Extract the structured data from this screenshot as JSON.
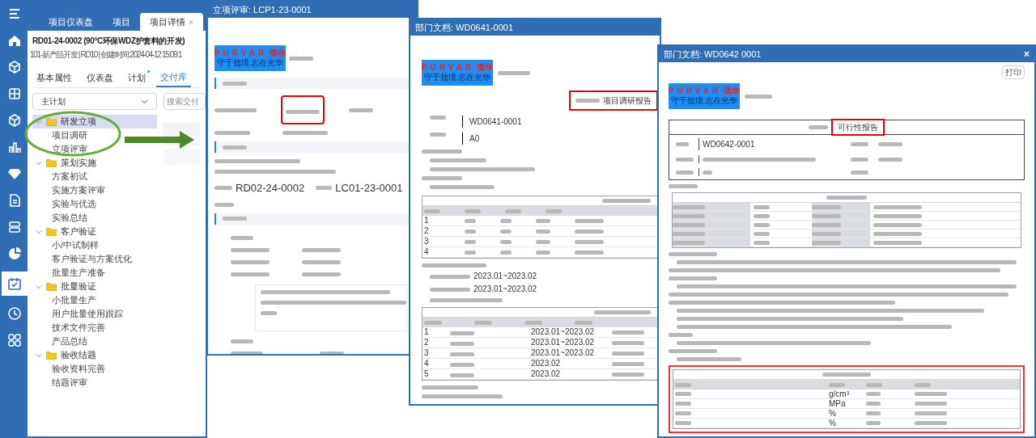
{
  "nav_items": [
    {
      "kind": "menu",
      "selected": false
    },
    {
      "kind": "home",
      "selected": false
    },
    {
      "kind": "cube",
      "selected": false
    },
    {
      "kind": "grid",
      "selected": false
    },
    {
      "kind": "cube",
      "selected": false
    },
    {
      "kind": "chart",
      "selected": false
    },
    {
      "kind": "gem",
      "selected": false
    },
    {
      "kind": "doc",
      "selected": false
    },
    {
      "kind": "stack",
      "selected": false
    },
    {
      "kind": "pie",
      "selected": false
    },
    {
      "kind": "calendar",
      "selected": true
    },
    {
      "kind": "clock",
      "selected": false
    },
    {
      "kind": "apps",
      "selected": false
    }
  ],
  "top_tabs": [
    {
      "label": "项目仪表盘",
      "selected": false
    },
    {
      "label": "项目",
      "selected": false
    },
    {
      "label": "项目详情",
      "selected": true,
      "close": "×"
    }
  ],
  "project": {
    "title": "RD01-24-0002 (90°C环保WDZ护套料的开发)",
    "subtitle": "101-新产品开发 | RD10 | 创建时间:2024-04-12 15:09:1"
  },
  "detail_tabs": [
    {
      "label": "基本属性",
      "selected": false,
      "dot": false
    },
    {
      "label": "仪表盘",
      "selected": false,
      "dot": false
    },
    {
      "label": "计划",
      "selected": false,
      "dot": true
    },
    {
      "label": "交付库",
      "selected": true,
      "dot": false
    }
  ],
  "plan_select": {
    "value": "主计划"
  },
  "search": {
    "placeholder": "搜索交付"
  },
  "tree": [
    {
      "label": "研发立项",
      "expanded": true,
      "selected": true,
      "children": [
        {
          "label": "项目调研"
        },
        {
          "label": "立项评审"
        }
      ]
    },
    {
      "label": "策划实施",
      "expanded": true,
      "selected": false,
      "children": [
        {
          "label": "方案初试"
        },
        {
          "label": "实施方案评审"
        },
        {
          "label": "实验与优选"
        },
        {
          "label": "实验总结"
        }
      ]
    },
    {
      "label": "客户验证",
      "expanded": true,
      "selected": false,
      "children": [
        {
          "label": "小/中试制样"
        },
        {
          "label": "客户验证与方案优化"
        },
        {
          "label": "批量生产准备"
        }
      ]
    },
    {
      "label": "批量验证",
      "expanded": true,
      "selected": false,
      "children": [
        {
          "label": "小批量生产"
        },
        {
          "label": "用户批量使用跟踪"
        },
        {
          "label": "技术文件完善"
        },
        {
          "label": "产品总结"
        }
      ]
    },
    {
      "label": "验收结题",
      "expanded": true,
      "selected": false,
      "children": [
        {
          "label": "验收资料完善"
        },
        {
          "label": "结题评审"
        }
      ]
    }
  ],
  "review_window": {
    "title": "立项评审: LCP1-23-0001",
    "logo": {
      "brand": "PURVAR",
      "brand_cn": "璞华",
      "slogan": "守于拙境 志在光华"
    },
    "project_code": "RD02-24-0002",
    "approval_code": "LC01-23-0001"
  },
  "doc_window_1": {
    "title": "部门文档: WD0641-0001",
    "logo": {
      "brand": "PURVAR",
      "brand_cn": "璞华",
      "slogan": "守于拙境 志在光华"
    },
    "doc_type": "项目调研报告",
    "doc_no": "WD0641-0001",
    "version": "A0",
    "table_1_rows": [
      "1",
      "2",
      "3",
      "4"
    ],
    "date_lines": [
      "2023.01~2023.02",
      "2023.01~2023.02"
    ],
    "table_2_rows": [
      {
        "no": "1",
        "period": "2023.01~2023.02"
      },
      {
        "no": "2",
        "period": "2023.01~2023.02"
      },
      {
        "no": "3",
        "period": "2023.01~2023.02"
      },
      {
        "no": "4",
        "period": "2023.02"
      },
      {
        "no": "5",
        "period": "2023.02"
      }
    ]
  },
  "doc_window_2": {
    "title": "部门文档: WD0642 0001",
    "close": "×",
    "print_button": "打印",
    "logo": {
      "brand": "PURVAR",
      "brand_cn": "璞华",
      "slogan": "守于拙境 志在光华"
    },
    "doc_type": "可行性报告",
    "doc_no": "WD0642-0001",
    "units": [
      "g/cm³",
      "MPa",
      "%",
      "%"
    ]
  }
}
